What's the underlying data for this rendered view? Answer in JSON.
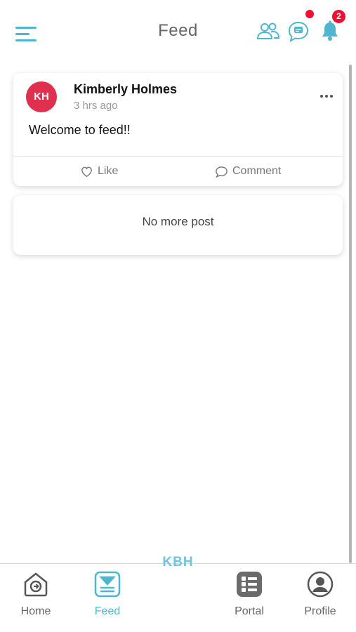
{
  "header": {
    "title": "Feed",
    "notification_count": "2",
    "icons": [
      "menu-icon",
      "friends-icon",
      "chat-icon",
      "bell-icon"
    ],
    "accent_color": "#4fb6cf",
    "badge_color": "#ee1133"
  },
  "post": {
    "avatar_initials": "KH",
    "avatar_color": "#e0304f",
    "author": "Kimberly Holmes",
    "time": "3 hrs ago",
    "text": "Welcome to feed!!",
    "like_label": "Like",
    "comment_label": "Comment"
  },
  "feed": {
    "end_message": "No more post"
  },
  "brand": "KBH",
  "nav": {
    "active": "Feed",
    "items": [
      {
        "label": "Home",
        "icon": "home-icon"
      },
      {
        "label": "Feed",
        "icon": "feed-icon"
      },
      {
        "label": "Portal",
        "icon": "portal-icon"
      },
      {
        "label": "Profile",
        "icon": "profile-icon"
      }
    ]
  }
}
